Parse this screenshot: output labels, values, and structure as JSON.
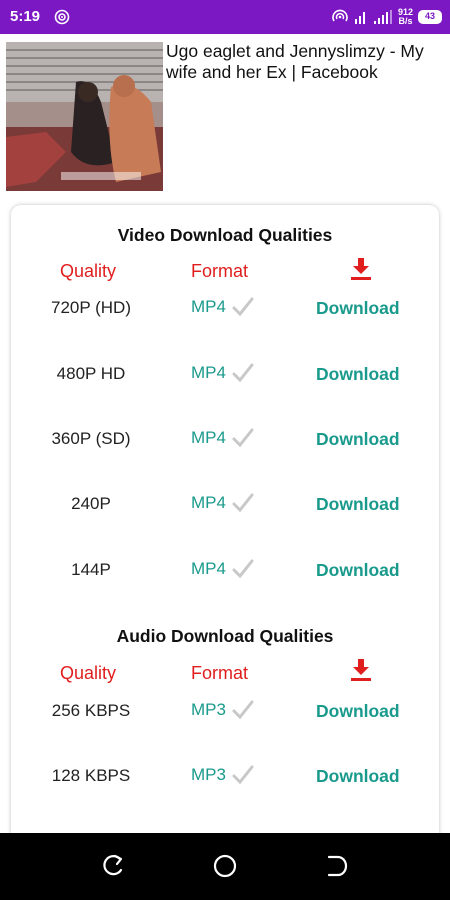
{
  "status_bar": {
    "time": "5:19",
    "net_speed_value": "912",
    "net_speed_unit": "B/s",
    "battery": "43",
    "bg_color": "#7b18c4"
  },
  "video": {
    "title": "Ugo eaglet and Jennyslimzy - My wife and her Ex | Facebook"
  },
  "video_section": {
    "title": "Video Download Qualities",
    "headers": {
      "quality": "Quality",
      "format": "Format"
    },
    "rows": [
      {
        "quality": "720P (HD)",
        "format": "MP4",
        "action": "Download"
      },
      {
        "quality": "480P HD",
        "format": "MP4",
        "action": "Download"
      },
      {
        "quality": "360P (SD)",
        "format": "MP4",
        "action": "Download"
      },
      {
        "quality": "240P",
        "format": "MP4",
        "action": "Download"
      },
      {
        "quality": "144P",
        "format": "MP4",
        "action": "Download"
      }
    ]
  },
  "audio_section": {
    "title": "Audio Download Qualities",
    "headers": {
      "quality": "Quality",
      "format": "Format"
    },
    "rows": [
      {
        "quality": "256 KBPS",
        "format": "MP3",
        "action": "Download"
      },
      {
        "quality": "128 KBPS",
        "format": "MP3",
        "action": "Download"
      }
    ]
  },
  "colors": {
    "header_red": "#e01e1e",
    "accent_teal": "#1a9a8c"
  }
}
